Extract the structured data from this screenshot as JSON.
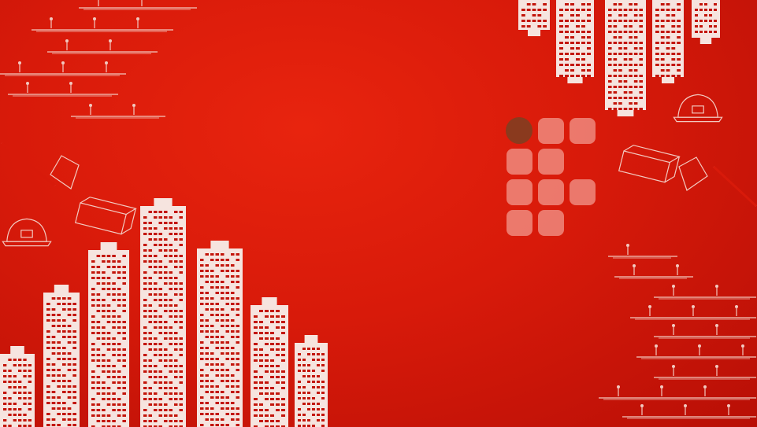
{
  "scene": {
    "colors": {
      "background": "#d81a0a",
      "background_dark": "#b80f06",
      "building": "#f6e4df",
      "sketch_line": "#f2c9c0",
      "tile": "#ee8a7e",
      "tile_active": "#8a3a1e"
    },
    "icons": [
      "helmet-icon",
      "axe-icon",
      "brick-icon",
      "building-icon",
      "worker-icon"
    ],
    "tile_grid": {
      "rows": 4,
      "cols": 3,
      "active_index": 0,
      "filled": [
        1,
        1,
        1,
        1,
        1,
        0,
        1,
        1,
        1,
        1,
        1,
        0
      ]
    }
  }
}
